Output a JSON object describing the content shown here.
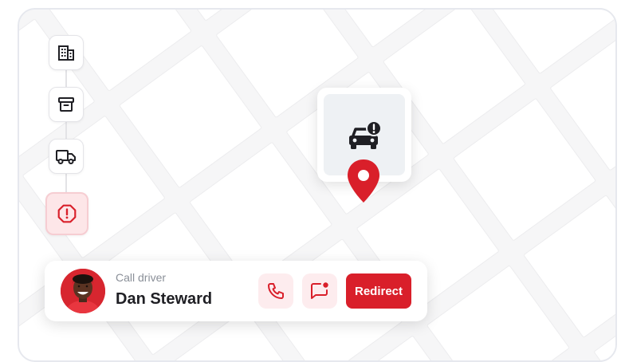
{
  "map": {
    "icon": "map-grid",
    "road_color": "#f6f6f7",
    "block_color": "#ffffff"
  },
  "timeline": {
    "steps": [
      {
        "icon": "building-icon"
      },
      {
        "icon": "archive-box-icon"
      },
      {
        "icon": "delivery-truck-icon"
      },
      {
        "icon": "alert-octagon-icon",
        "status": "alert"
      }
    ]
  },
  "popup": {
    "icon": "car-alert-icon",
    "pin_icon": "map-pin-icon",
    "pin_color": "#d91f2a"
  },
  "driver_card": {
    "subtitle": "Call driver",
    "driver_name": "Dan Steward",
    "call_icon": "phone-icon",
    "message_icon": "message-notification-icon",
    "redirect_label": "Redirect",
    "accent": "#d91f2a"
  }
}
